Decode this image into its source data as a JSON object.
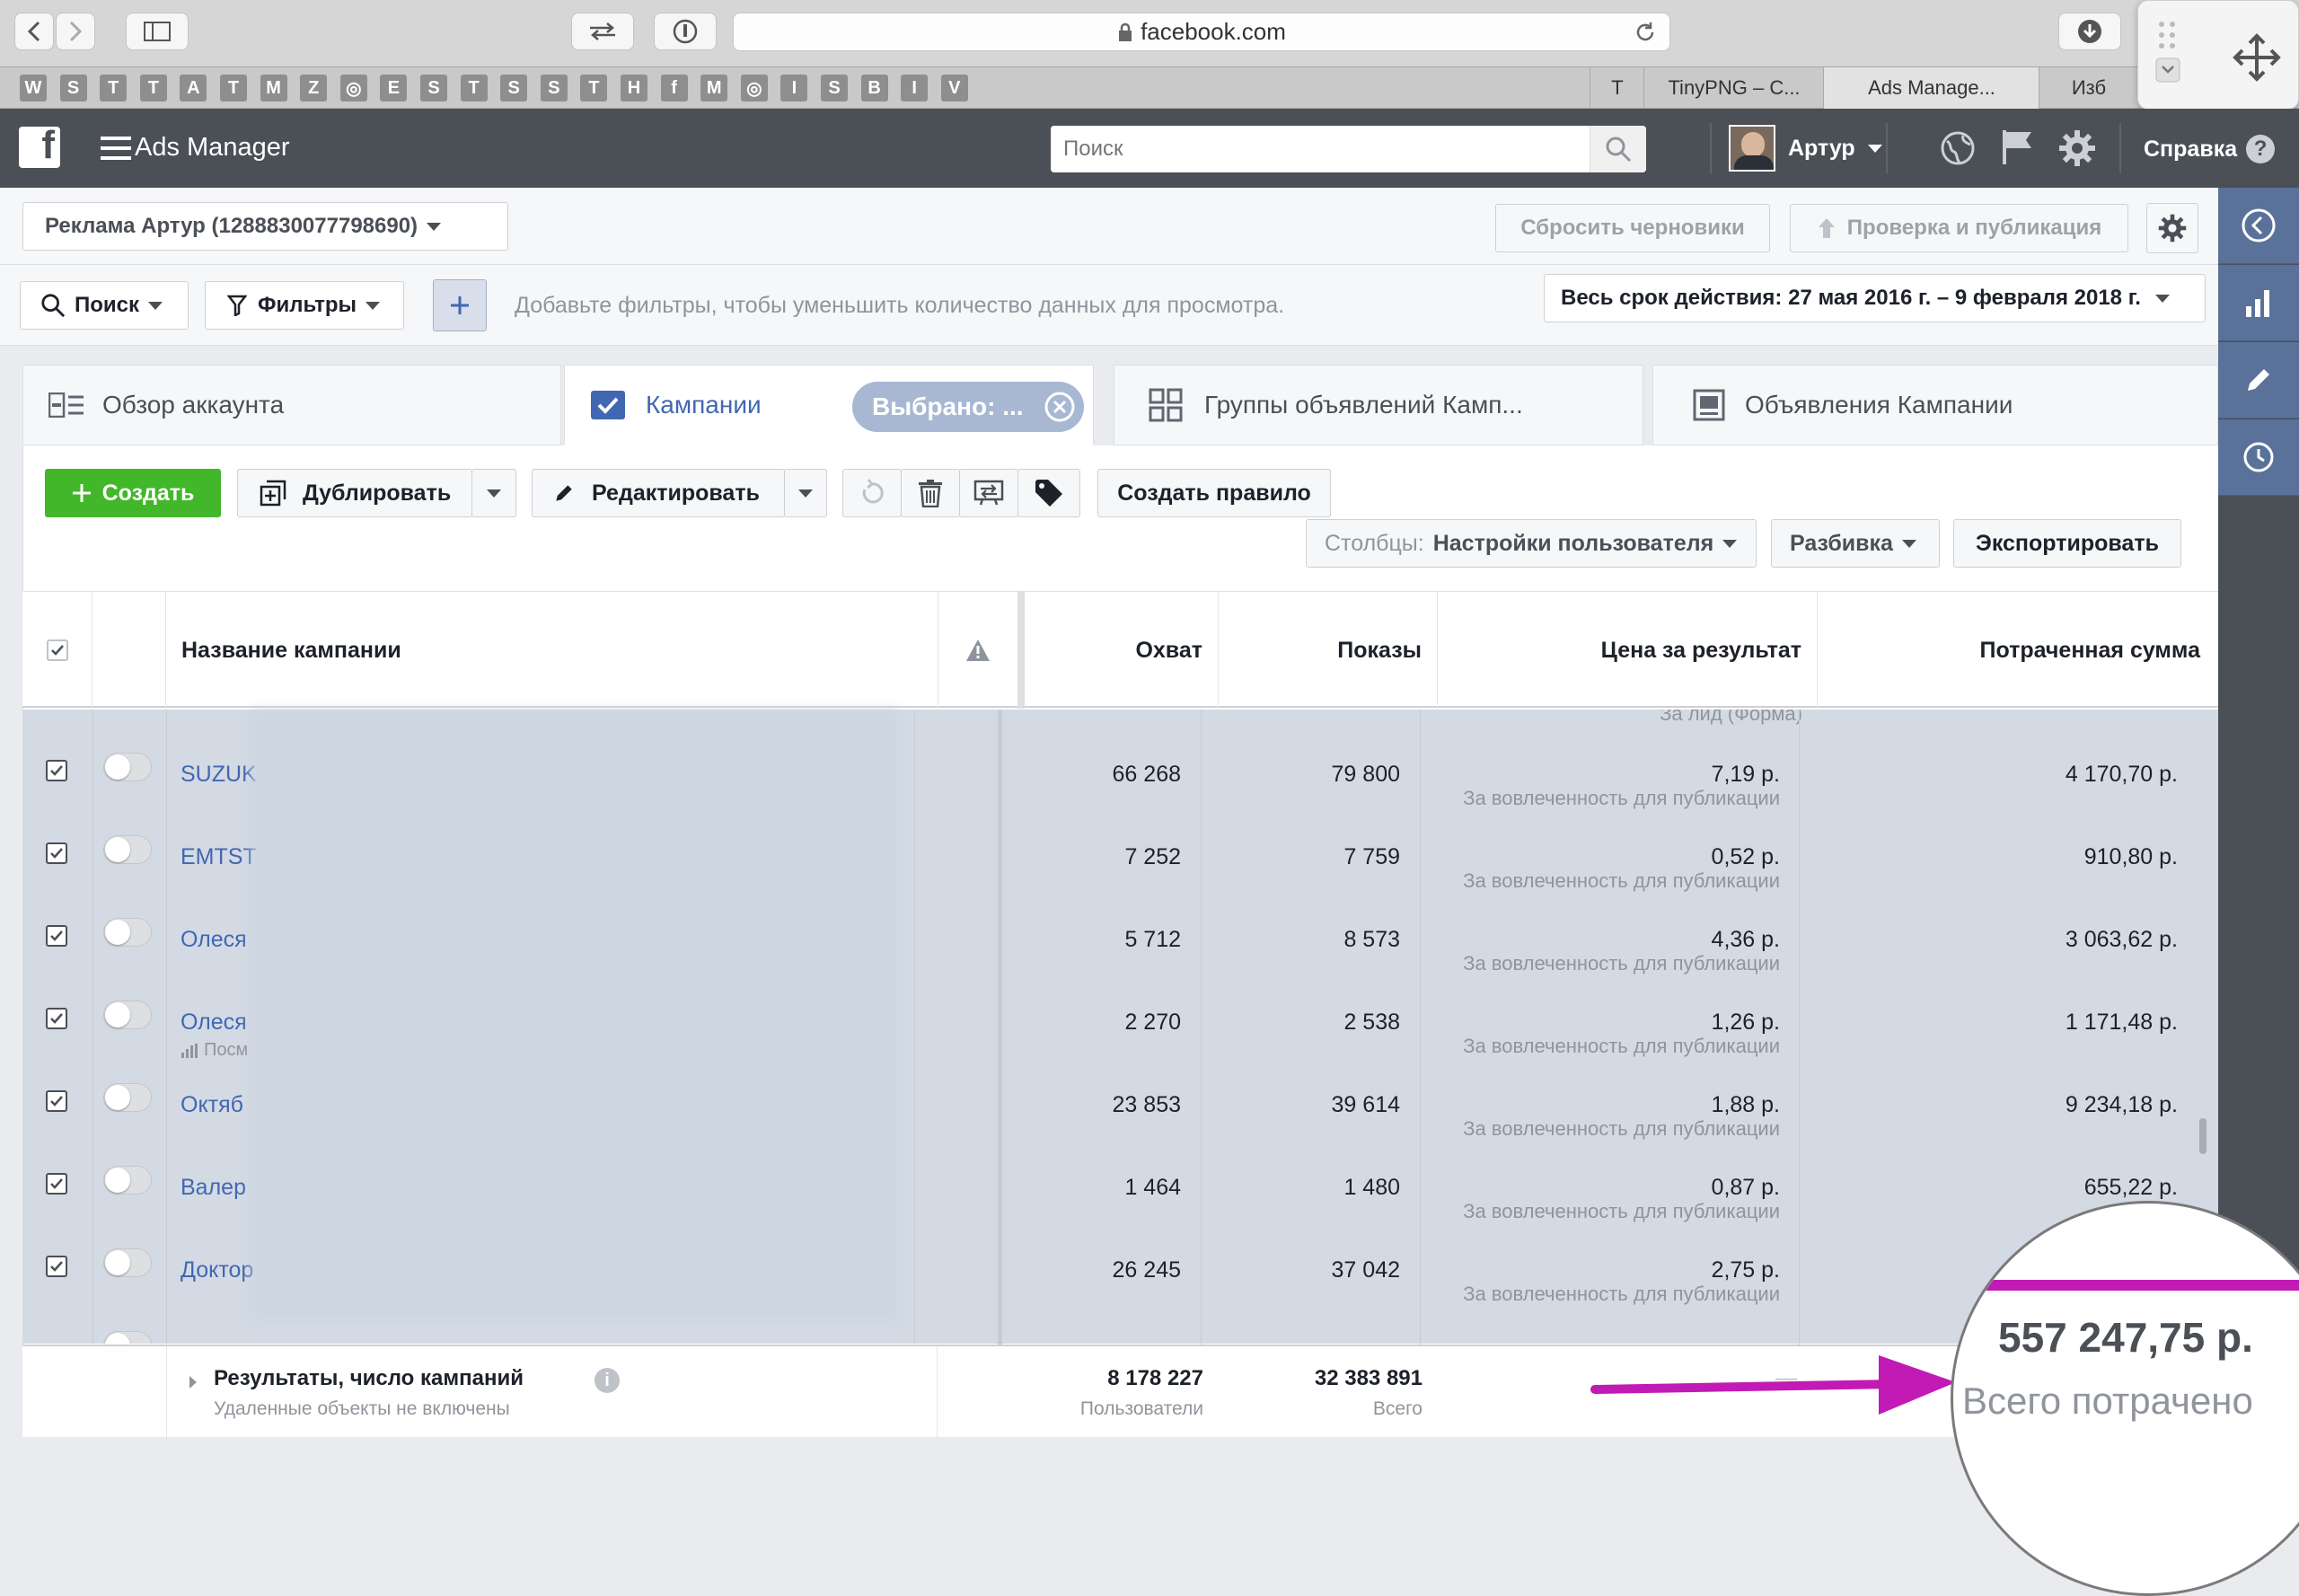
{
  "browser": {
    "url": "facebook.com",
    "favorites": [
      "W",
      "S",
      "T",
      "T",
      "A",
      "T",
      "M",
      "Z",
      "◎",
      "E",
      "S",
      "T",
      "S",
      "S",
      "T",
      "H",
      "f",
      "M",
      "◎",
      "I",
      "S",
      "B",
      "I",
      "V"
    ],
    "tabs": [
      {
        "label": "T"
      },
      {
        "label": "TinyPNG – C..."
      },
      {
        "label": "Ads Manage..."
      },
      {
        "label": "Изб"
      }
    ]
  },
  "header": {
    "app_title": "Ads Manager",
    "search_placeholder": "Поиск",
    "user_name": "Артур",
    "help_label": "Справка"
  },
  "account": {
    "selector_label": "Реклама Артур (1288830077798690)",
    "reset_drafts": "Сбросить черновики",
    "review_publish": "Проверка и публикация"
  },
  "filters": {
    "search_label": "Поиск",
    "filters_label": "Фильтры",
    "hint": "Добавьте фильтры, чтобы уменьшить количество данных для просмотра.",
    "date_range": "Весь срок действия: 27 мая 2016 г. – 9 февраля 2018 г."
  },
  "tabs": {
    "overview": "Обзор аккаунта",
    "campaigns": "Кампании",
    "selected": "Выбрано: ...",
    "adsets": "Группы объявлений Камп...",
    "ads": "Объявления Кампании"
  },
  "toolbar": {
    "create": "Создать",
    "duplicate": "Дублировать",
    "edit": "Редактировать",
    "create_rule": "Создать правило",
    "columns_prefix": "Столбцы:",
    "columns_value": "Настройки пользователя",
    "breakdown": "Разбивка",
    "export": "Экспортировать"
  },
  "table": {
    "columns": {
      "name": "Название кампании",
      "reach": "Охват",
      "impressions": "Показы",
      "cost_per_result": "Цена за результат",
      "spent": "Потраченная сумма"
    },
    "top_partial_sub": "За лид (Форма)",
    "rows": [
      {
        "name": "SUZUK",
        "extra": "",
        "reach": "66 268",
        "impressions": "79 800",
        "cost": "7,19 р.",
        "cost_note": "За вовлеченность для публикации",
        "spent": "4 170,70 р."
      },
      {
        "name": "EMTST",
        "extra": "",
        "reach": "7 252",
        "impressions": "7 759",
        "cost": "0,52 р.",
        "cost_note": "За вовлеченность для публикации",
        "spent": "910,80 р."
      },
      {
        "name": "Олеся",
        "extra": "",
        "reach": "5 712",
        "impressions": "8 573",
        "cost": "4,36 р.",
        "cost_note": "За вовлеченность для публикации",
        "spent": "3 063,62 р."
      },
      {
        "name": "Олеся",
        "extra": "Посм",
        "reach": "2 270",
        "impressions": "2 538",
        "cost": "1,26 р.",
        "cost_note": "За вовлеченность для публикации",
        "spent": "1 171,48 р."
      },
      {
        "name": "Октяб",
        "extra": "",
        "reach": "23 853",
        "impressions": "39 614",
        "cost": "1,88 р.",
        "cost_note": "За вовлеченность для публикации",
        "spent": "9 234,18 р."
      },
      {
        "name": "Валер",
        "extra": "",
        "reach": "1 464",
        "impressions": "1 480",
        "cost": "0,87 р.",
        "cost_note": "За вовлеченность для публикации",
        "spent": "655,22 р."
      },
      {
        "name": "Доктор",
        "extra": "",
        "reach": "26 245",
        "impressions": "37 042",
        "cost": "2,75 р.",
        "cost_note": "За вовлеченность для публикации",
        "spent": ""
      }
    ],
    "totals": {
      "label": "Результаты, число кампаний",
      "sublabel": "Удаленные объекты не включены",
      "reach": "8 178 227",
      "reach_sub": "Пользователи",
      "impressions": "32 383 891",
      "impressions_sub": "Всего",
      "cost": "—"
    }
  },
  "callout": {
    "amount": "557 247,75 р.",
    "caption": "Всего потрачено",
    "color": "#c21ab4"
  }
}
